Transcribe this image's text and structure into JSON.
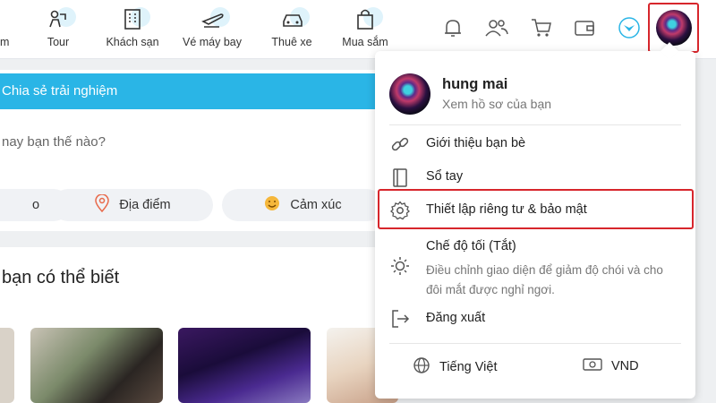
{
  "nav": {
    "partial_label": "m",
    "items": [
      {
        "name": "tour",
        "label": "Tour"
      },
      {
        "name": "hotel",
        "label": "Khách sạn"
      },
      {
        "name": "flight",
        "label": "Vé máy bay"
      },
      {
        "name": "car-rental",
        "label": "Thuê xe"
      },
      {
        "name": "shopping",
        "label": "Mua sắm"
      }
    ],
    "icon_names": [
      "bell-icon",
      "friends-icon",
      "cart-icon",
      "wallet-icon",
      "brand-logo-icon"
    ],
    "accent_color": "#2ab5e6",
    "highlight_color": "#d7262c"
  },
  "feed": {
    "share_header": "Chia sẻ trải nghiệm",
    "prompt": "nay bạn thế nào?",
    "pills": [
      {
        "icon": "photo-icon",
        "label": "o"
      },
      {
        "icon": "location-pin-icon",
        "label": "Địa điểm"
      },
      {
        "icon": "smiley-icon",
        "label": "Cảm xúc"
      }
    ],
    "suggestions_title": "bạn có thể biết"
  },
  "menu": {
    "profile_name": "hung mai",
    "profile_sub": "Xem hồ sơ của bạn",
    "items": [
      {
        "icon": "link-icon",
        "label": "Giới thiệu bạn bè"
      },
      {
        "icon": "notebook-icon",
        "label": "Sổ tay"
      },
      {
        "icon": "gear-icon",
        "label": "Thiết lập riêng tư & bảo mật"
      },
      {
        "icon": "sun-icon",
        "label": "Chế độ tối (Tắt)",
        "description": "Điều chỉnh giao diện để giảm độ chói và cho đôi mắt được nghỉ ngơi."
      },
      {
        "icon": "logout-icon",
        "label": "Đăng xuất"
      }
    ],
    "language": "Tiếng Việt",
    "currency": "VND"
  }
}
